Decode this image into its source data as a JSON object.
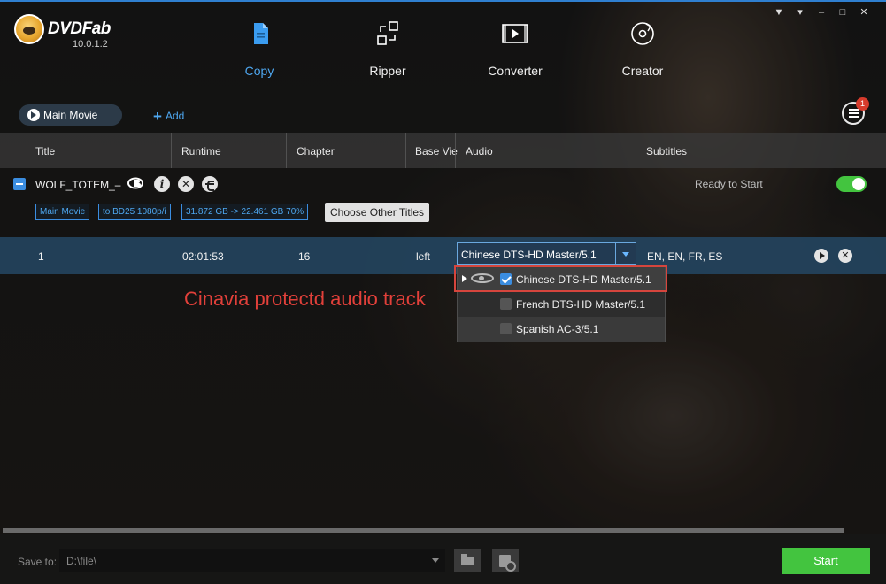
{
  "app": {
    "logo_text": "DVDFab",
    "version": "10.0.1.2"
  },
  "nav": [
    {
      "label": "Copy",
      "icon": "copy-icon",
      "active": true
    },
    {
      "label": "Ripper",
      "icon": "ripper-icon"
    },
    {
      "label": "Converter",
      "icon": "converter-icon"
    },
    {
      "label": "Creator",
      "icon": "creator-icon"
    }
  ],
  "toolbar": {
    "main_movie_label": "Main Movie",
    "add_label": "Add",
    "task_badge": "1"
  },
  "columns": [
    "Title",
    "Runtime",
    "Chapter",
    "Base Vie",
    "Audio",
    "Subtitles"
  ],
  "title_item": {
    "name": "WOLF_TOTEM_–",
    "status": "Ready to Start",
    "tags": [
      "Main Movie",
      "to BD25 1080p/i",
      "31.872 GB -> 22.461 GB 70%"
    ],
    "choose_other": "Choose Other Titles"
  },
  "row": {
    "title": "1",
    "runtime": "02:01:53",
    "chapter": "16",
    "base_view": "left",
    "audio": "Chinese DTS-HD Master/5.1",
    "subtitles": "EN, EN, FR, ES"
  },
  "audio_options": [
    {
      "label": "Chinese DTS-HD Master/5.1",
      "checked": true
    },
    {
      "label": "French DTS-HD Master/5.1",
      "checked": false
    },
    {
      "label": "Spanish AC-3/5.1",
      "checked": false
    }
  ],
  "annotation": "Cinavia protectd audio track",
  "bottom": {
    "save_label": "Save to:",
    "save_path": "D:\\file\\",
    "start_label": "Start"
  },
  "colors": {
    "accent": "#3b8de0",
    "start": "#43c43f",
    "annotation": "#e2403a",
    "row_highlight": "#244864"
  }
}
